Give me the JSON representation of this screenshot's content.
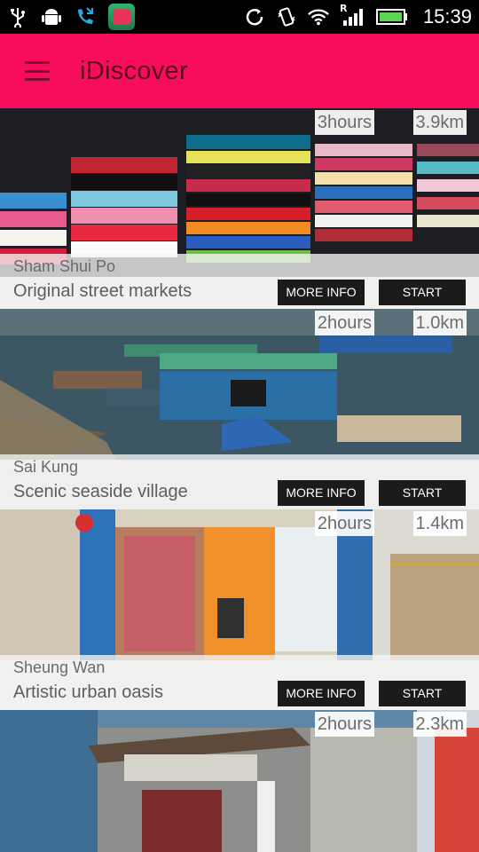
{
  "status_bar": {
    "time": "15:39",
    "icons": [
      "usb-icon",
      "android-icon",
      "missed-call-icon",
      "app-icon",
      "sync-icon",
      "vibrate-icon",
      "wifi-icon",
      "signal-icon",
      "battery-icon"
    ],
    "roaming_label": "R"
  },
  "app_bar": {
    "title": "iDiscover",
    "menu_icon": "hamburger-menu-icon",
    "background": "#f70d5b"
  },
  "tours": [
    {
      "place": "",
      "tagline": "",
      "duration": "3hours",
      "distance": "3.9km",
      "partial": true
    },
    {
      "place": "Sham Shui Po",
      "tagline": "Original street markets",
      "duration": "2hours",
      "distance": "1.0km",
      "more_label": "MORE INFO",
      "start_label": "START"
    },
    {
      "place": "Sai Kung",
      "tagline": "Scenic seaside village",
      "duration": "2hours",
      "distance": "1.4km",
      "more_label": "MORE INFO",
      "start_label": "START"
    },
    {
      "place": "Sheung Wan",
      "tagline": "Artistic urban oasis",
      "duration": "2hours",
      "distance": "2.3km",
      "more_label": "MORE INFO",
      "start_label": "START"
    }
  ]
}
